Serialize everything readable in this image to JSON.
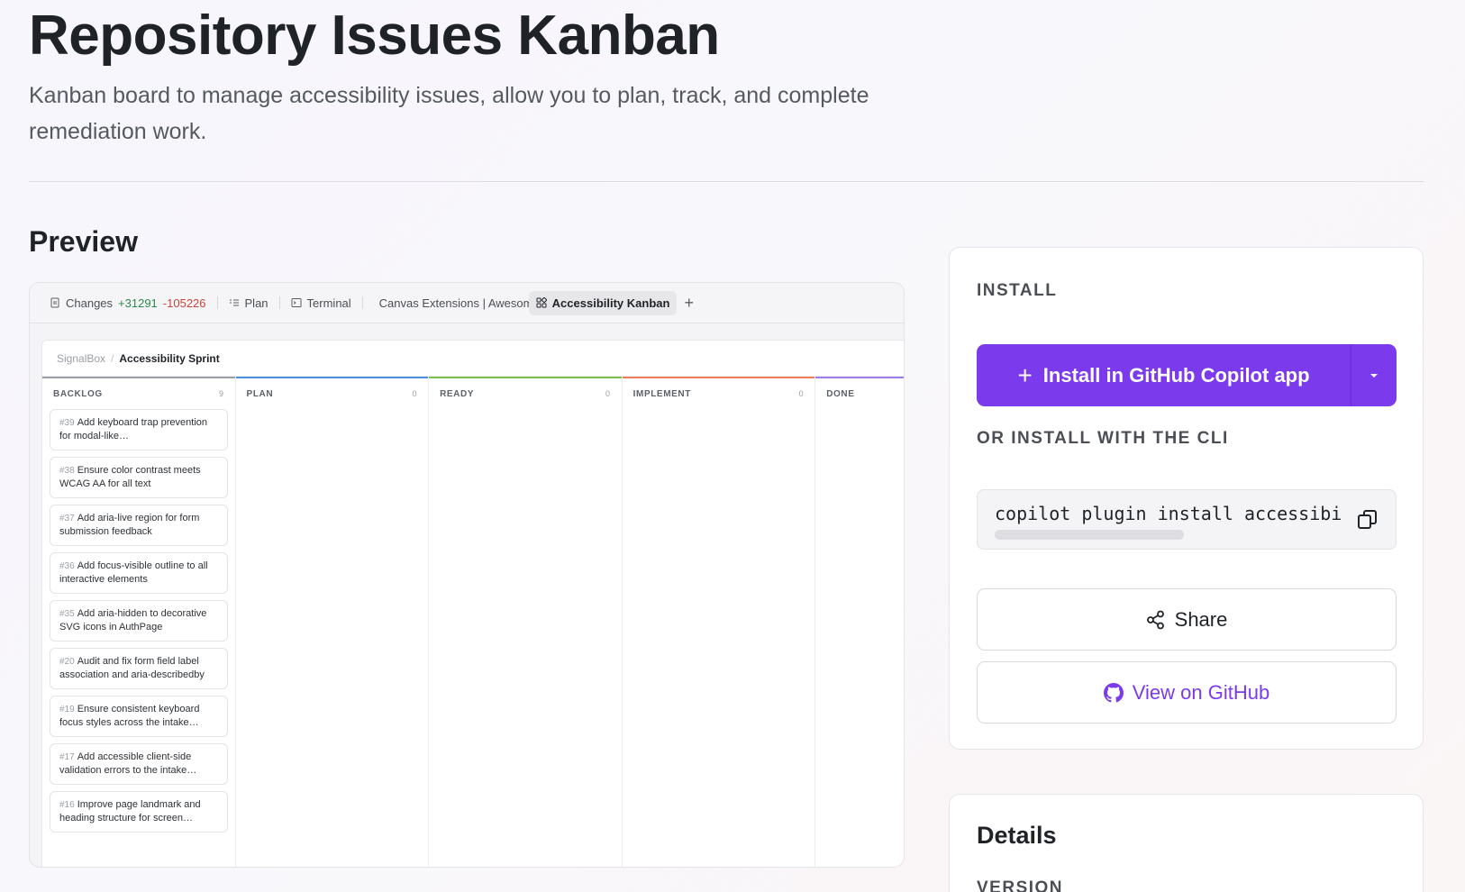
{
  "page": {
    "title": "Repository Issues Kanban",
    "subtitle": "Kanban board to manage accessibility issues, allow you to plan, track, and complete remediation work.",
    "preview_heading": "Preview"
  },
  "preview": {
    "tabs": [
      {
        "label": "Changes",
        "icon": "file-icon",
        "additions": "+31291",
        "deletions": "-105226"
      },
      {
        "label": "Plan",
        "icon": "list-icon"
      },
      {
        "label": "Terminal",
        "icon": "terminal-icon"
      },
      {
        "label": "Canvas Extensions | Awesome",
        "icon": "globe-icon"
      },
      {
        "label": "Accessibility Kanban",
        "icon": "apps-icon",
        "active": true
      }
    ],
    "breadcrumb": {
      "root": "SignalBox",
      "separator": "/",
      "current": "Accessibility Sprint"
    },
    "columns": [
      {
        "name": "BACKLOG",
        "count": "9",
        "color": "#9aa0a6"
      },
      {
        "name": "PLAN",
        "count": "0",
        "color": "#4a90e2"
      },
      {
        "name": "READY",
        "count": "0",
        "color": "#7cc04b"
      },
      {
        "name": "IMPLEMENT",
        "count": "0",
        "color": "#ef7d57"
      },
      {
        "name": "DONE",
        "count": "",
        "color": "#9b7ee8"
      }
    ],
    "cards": [
      {
        "num": "#39",
        "title": "Add keyboard trap prevention for modal-like…"
      },
      {
        "num": "#38",
        "title": "Ensure color contrast meets WCAG AA for all text"
      },
      {
        "num": "#37",
        "title": "Add aria-live region for form submission feedback"
      },
      {
        "num": "#36",
        "title": "Add focus-visible outline to all interactive elements"
      },
      {
        "num": "#35",
        "title": "Add aria-hidden to decorative SVG icons in AuthPage"
      },
      {
        "num": "#20",
        "title": "Audit and fix form field label association and aria-describedby"
      },
      {
        "num": "#19",
        "title": "Ensure consistent keyboard focus styles across the intake…"
      },
      {
        "num": "#17",
        "title": "Add accessible client-side validation errors to the intake…"
      },
      {
        "num": "#16",
        "title": "Improve page landmark and heading structure for screen…"
      }
    ]
  },
  "install": {
    "heading": "INSTALL",
    "button_label": "Install in GitHub Copilot app",
    "cli_heading": "OR INSTALL WITH THE CLI",
    "cli_command": "copilot plugin install accessibility-kanban",
    "share_label": "Share",
    "github_label": "View on GitHub",
    "accent": "#7c3aed"
  },
  "details": {
    "heading": "Details",
    "version_label": "VERSION"
  }
}
